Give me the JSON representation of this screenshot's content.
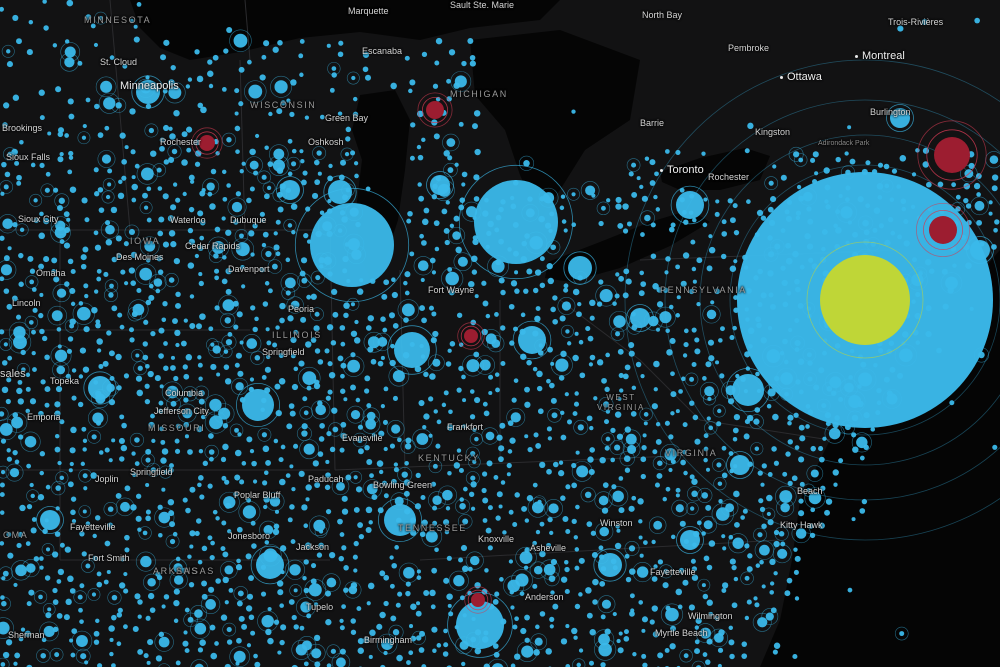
{
  "colors": {
    "background": "#0b0b0c",
    "land": "#121213",
    "water": "#050505",
    "border": "#2b2b2e",
    "point_fill": "#3bb9ea",
    "point_ring": "#3bb9ea",
    "hotspot_fill": "#9c1d30",
    "hotspot_ring": "#d23a52",
    "highlight_fill": "#bfd637"
  },
  "labels": {
    "states": [
      {
        "id": "minnesota",
        "text": "MINNESOTA"
      },
      {
        "id": "wisconsin",
        "text": "WISCONSIN"
      },
      {
        "id": "michigan",
        "text": "MICHIGAN"
      },
      {
        "id": "iowa",
        "text": "IOWA"
      },
      {
        "id": "illinois",
        "text": "ILLINOIS"
      },
      {
        "id": "missouri",
        "text": "MISSOURI"
      },
      {
        "id": "kentucky",
        "text": "KENTUCKY"
      },
      {
        "id": "west-virginia",
        "text": "WEST\nVIRGINIA"
      },
      {
        "id": "virginia",
        "text": "VIRGINIA"
      },
      {
        "id": "pennsylvania",
        "text": "PENNSYLVANIA"
      },
      {
        "id": "arkansas",
        "text": "ARKANSAS"
      },
      {
        "id": "tennessee",
        "text": "TENNESSEE"
      },
      {
        "id": "oklahoma",
        "text": "OMA"
      },
      {
        "id": "kansas",
        "text": "SAS"
      }
    ],
    "cities": [
      {
        "id": "st-cloud",
        "text": "St. Cloud"
      },
      {
        "id": "minneapolis",
        "text": "Minneapolis"
      },
      {
        "id": "brookings",
        "text": "Brookings"
      },
      {
        "id": "sioux-falls",
        "text": "Sioux Falls"
      },
      {
        "id": "rochester",
        "text": "Rochester"
      },
      {
        "id": "sioux-city",
        "text": "Sioux City"
      },
      {
        "id": "omaha",
        "text": "Omaha"
      },
      {
        "id": "lincoln",
        "text": "Lincoln"
      },
      {
        "id": "des-moines",
        "text": "Des Moines"
      },
      {
        "id": "waterloo",
        "text": "Waterloo"
      },
      {
        "id": "dubuque",
        "text": "Dubuque"
      },
      {
        "id": "cedar-rapids",
        "text": "Cedar Rapids"
      },
      {
        "id": "davenport",
        "text": "Davenport"
      },
      {
        "id": "marquette",
        "text": "Marquette"
      },
      {
        "id": "escanaba",
        "text": "Escanaba"
      },
      {
        "id": "sault-ste-marie",
        "text": "Sault Ste. Marie"
      },
      {
        "id": "green-bay",
        "text": "Green Bay"
      },
      {
        "id": "oshkosh",
        "text": "Oshkosh"
      },
      {
        "id": "north-bay",
        "text": "North Bay"
      },
      {
        "id": "pembroke",
        "text": "Pembroke"
      },
      {
        "id": "ottawa",
        "text": "Ottawa"
      },
      {
        "id": "montreal",
        "text": "Montreal"
      },
      {
        "id": "trois-rivieres",
        "text": "Trois-Rivières"
      },
      {
        "id": "kingston",
        "text": "Kingston"
      },
      {
        "id": "barrie",
        "text": "Barrie"
      },
      {
        "id": "toronto",
        "text": "Toronto"
      },
      {
        "id": "rochester-ny",
        "text": "Rochester"
      },
      {
        "id": "burlington",
        "text": "Burlington"
      },
      {
        "id": "adirondack",
        "text": "Adirondack Park"
      },
      {
        "id": "peoria",
        "text": "Peoria"
      },
      {
        "id": "springfield",
        "text": "Springfield"
      },
      {
        "id": "fort-wayne",
        "text": "Fort Wayne"
      },
      {
        "id": "topeka",
        "text": "Topeka"
      },
      {
        "id": "emporia",
        "text": "Emporia"
      },
      {
        "id": "columbia",
        "text": "Columbia"
      },
      {
        "id": "jefferson-city",
        "text": "Jefferson City"
      },
      {
        "id": "springfield-mo",
        "text": "Springfield"
      },
      {
        "id": "joplin",
        "text": "Joplin"
      },
      {
        "id": "evansville",
        "text": "Evansville"
      },
      {
        "id": "paducah",
        "text": "Paducah"
      },
      {
        "id": "bowling-green",
        "text": "Bowling Green"
      },
      {
        "id": "frankfort",
        "text": "Frankfort"
      },
      {
        "id": "poplar-bluff",
        "text": "Poplar Bluff"
      },
      {
        "id": "fayetteville",
        "text": "Fayetteville"
      },
      {
        "id": "fort-smith",
        "text": "Fort Smith"
      },
      {
        "id": "jonesboro",
        "text": "Jonesboro"
      },
      {
        "id": "jackson",
        "text": "Jackson"
      },
      {
        "id": "knoxville",
        "text": "Knoxville"
      },
      {
        "id": "asheville",
        "text": "Asheville"
      },
      {
        "id": "anderson",
        "text": "Anderson"
      },
      {
        "id": "winston-salem",
        "text": "Winston"
      },
      {
        "id": "fayetteville-nc",
        "text": "Fayetteville"
      },
      {
        "id": "wilmington",
        "text": "Wilmington"
      },
      {
        "id": "myrtle-beach",
        "text": "Myrtle Beach"
      },
      {
        "id": "kitty-hawk",
        "text": "Kitty Hawk"
      },
      {
        "id": "virginia-beach",
        "text": "Beach"
      },
      {
        "id": "birmingham",
        "text": "Birmingham"
      },
      {
        "id": "tupelo",
        "text": "Tupelo"
      },
      {
        "id": "sherman",
        "text": "Sherman"
      },
      {
        "id": "sales",
        "text": "sales"
      }
    ]
  }
}
